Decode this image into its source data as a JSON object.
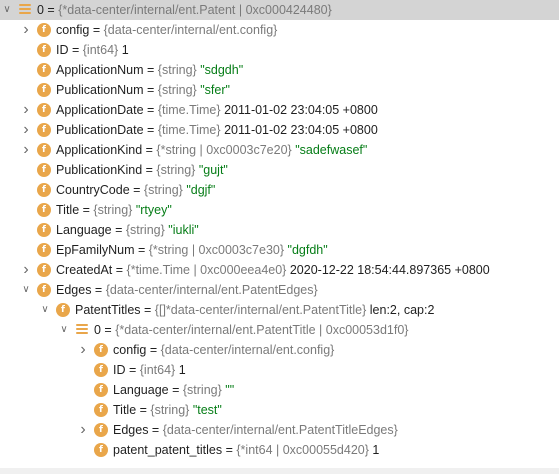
{
  "accent": "#e9a64a",
  "rows": [
    {
      "indent": 0,
      "expander": "open",
      "icon": "list",
      "name": "0",
      "type": "{*data-center/internal/ent.Patent | 0xc000424480}",
      "value": "",
      "vclass": "val-plain",
      "selected": true
    },
    {
      "indent": 1,
      "expander": "closed",
      "icon": "field",
      "name": "config",
      "type": "{data-center/internal/ent.config}",
      "value": "",
      "vclass": "val-plain"
    },
    {
      "indent": 1,
      "expander": "none",
      "icon": "field",
      "name": "ID",
      "type": "{int64}",
      "value": "1",
      "vclass": "val-num"
    },
    {
      "indent": 1,
      "expander": "none",
      "icon": "field",
      "name": "ApplicationNum",
      "type": "{string}",
      "value": "\"sdgdh\"",
      "vclass": "val-str"
    },
    {
      "indent": 1,
      "expander": "none",
      "icon": "field",
      "name": "PublicationNum",
      "type": "{string}",
      "value": "\"sfer\"",
      "vclass": "val-str"
    },
    {
      "indent": 1,
      "expander": "closed",
      "icon": "field",
      "name": "ApplicationDate",
      "type": "{time.Time}",
      "value": "2011-01-02 23:04:05 +0800",
      "vclass": "val-plain"
    },
    {
      "indent": 1,
      "expander": "closed",
      "icon": "field",
      "name": "PublicationDate",
      "type": "{time.Time}",
      "value": "2011-01-02 23:04:05 +0800",
      "vclass": "val-plain"
    },
    {
      "indent": 1,
      "expander": "closed",
      "icon": "field",
      "name": "ApplicationKind",
      "type": "{*string | 0xc0003c7e20}",
      "value": "\"sadefwasef\"",
      "vclass": "val-str"
    },
    {
      "indent": 1,
      "expander": "none",
      "icon": "field",
      "name": "PublicationKind",
      "type": "{string}",
      "value": "\"gujt\"",
      "vclass": "val-str"
    },
    {
      "indent": 1,
      "expander": "none",
      "icon": "field",
      "name": "CountryCode",
      "type": "{string}",
      "value": "\"dgjf\"",
      "vclass": "val-str"
    },
    {
      "indent": 1,
      "expander": "none",
      "icon": "field",
      "name": "Title",
      "type": "{string}",
      "value": "\"rtyey\"",
      "vclass": "val-str"
    },
    {
      "indent": 1,
      "expander": "none",
      "icon": "field",
      "name": "Language",
      "type": "{string}",
      "value": "\"iukli\"",
      "vclass": "val-str"
    },
    {
      "indent": 1,
      "expander": "none",
      "icon": "field",
      "name": "EpFamilyNum",
      "type": "{*string | 0xc0003c7e30}",
      "value": "\"dgfdh\"",
      "vclass": "val-str"
    },
    {
      "indent": 1,
      "expander": "closed",
      "icon": "field",
      "name": "CreatedAt",
      "type": "{*time.Time | 0xc000eea4e0}",
      "value": "2020-12-22 18:54:44.897365 +0800",
      "vclass": "val-plain"
    },
    {
      "indent": 1,
      "expander": "open",
      "icon": "field",
      "name": "Edges",
      "type": "{data-center/internal/ent.PatentEdges}",
      "value": "",
      "vclass": "val-plain"
    },
    {
      "indent": 2,
      "expander": "open",
      "icon": "field",
      "name": "PatentTitles",
      "type": "{[]*data-center/internal/ent.PatentTitle}",
      "value": "len:2, cap:2",
      "vclass": "val-plain"
    },
    {
      "indent": 3,
      "expander": "open",
      "icon": "list",
      "name": "0",
      "type": "{*data-center/internal/ent.PatentTitle | 0xc00053d1f0}",
      "value": "",
      "vclass": "val-plain"
    },
    {
      "indent": 4,
      "expander": "closed",
      "icon": "field",
      "name": "config",
      "type": "{data-center/internal/ent.config}",
      "value": "",
      "vclass": "val-plain"
    },
    {
      "indent": 4,
      "expander": "none",
      "icon": "field",
      "name": "ID",
      "type": "{int64}",
      "value": "1",
      "vclass": "val-num"
    },
    {
      "indent": 4,
      "expander": "none",
      "icon": "field",
      "name": "Language",
      "type": "{string}",
      "value": "\"\"",
      "vclass": "val-str"
    },
    {
      "indent": 4,
      "expander": "none",
      "icon": "field",
      "name": "Title",
      "type": "{string}",
      "value": "\"test\"",
      "vclass": "val-str"
    },
    {
      "indent": 4,
      "expander": "closed",
      "icon": "field",
      "name": "Edges",
      "type": "{data-center/internal/ent.PatentTitleEdges}",
      "value": "",
      "vclass": "val-plain"
    },
    {
      "indent": 4,
      "expander": "none",
      "icon": "field",
      "name": "patent_patent_titles",
      "type": "{*int64 | 0xc00055d420}",
      "value": "1",
      "vclass": "val-num"
    }
  ]
}
